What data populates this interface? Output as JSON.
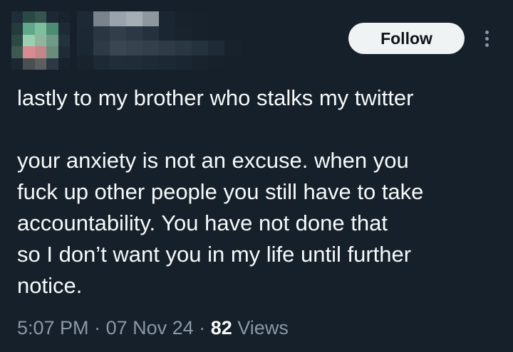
{
  "header": {
    "follow_label": "Follow",
    "avatar_icon": "blurred-avatar",
    "more_icon": "more-options-icon"
  },
  "tweet": {
    "line1": "lastly to my brother who stalks my twitter",
    "line2": "your anxiety is not an excuse. when you",
    "line3": "fuck up other people you still have to take",
    "line4": "accountability. You have not done that",
    "line5": "so I don’t want you in my life until further",
    "line6": "notice."
  },
  "meta": {
    "time": "5:07 PM",
    "separator": "·",
    "date": "07 Nov 24",
    "views_count": "82",
    "views_label": "Views"
  },
  "colors": {
    "background": "#15202b",
    "text": "#f7f9f9",
    "muted": "#8b98a5",
    "button_bg": "#eff3f4"
  }
}
